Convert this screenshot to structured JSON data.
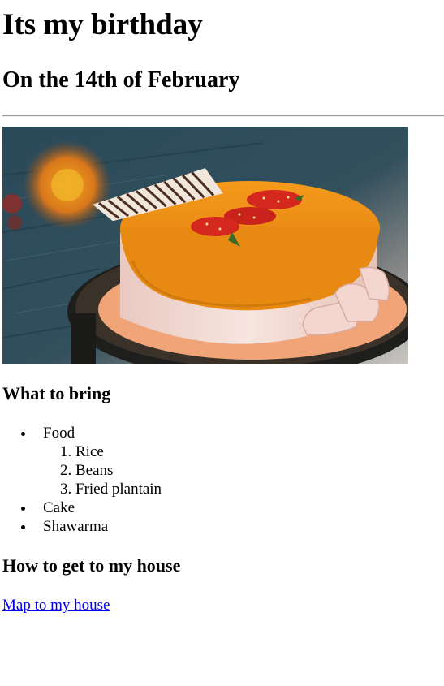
{
  "page": {
    "title": "Its my birthday",
    "subtitle": "On the 14th of February"
  },
  "image": {
    "subject": "cake",
    "colors": {
      "glaze": "#E8860F",
      "cream": "#F4DCD6",
      "board": "#F0A478",
      "background": "#2A4A5A",
      "strawberry": "#D4281F",
      "chocolate": "#5A3A2A"
    }
  },
  "bring": {
    "heading": "What to bring",
    "items": [
      {
        "label": "Food",
        "sub": [
          "Rice",
          "Beans",
          "Fried plantain"
        ]
      },
      {
        "label": "Cake"
      },
      {
        "label": "Shawarma"
      }
    ]
  },
  "house": {
    "heading": "How to get to my house",
    "link_text": "Map to my house",
    "link_color": "#0000EE"
  }
}
